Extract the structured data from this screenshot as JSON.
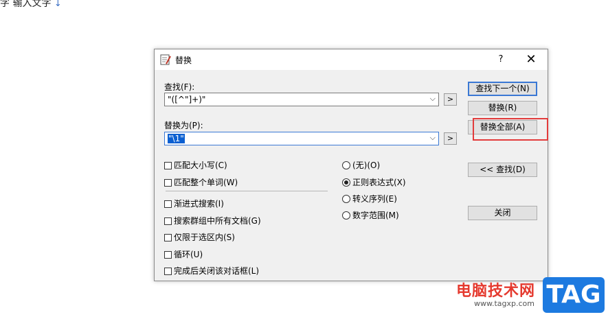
{
  "document": {
    "visible_text": "字 输入文字",
    "para_mark": "↓"
  },
  "dialog": {
    "title": "替换",
    "help": "?",
    "close": "✕",
    "find_label": "查找(F):",
    "find_value": "\"([^\"]+)\"",
    "replace_label": "替换为(P):",
    "replace_value": "\"\\1\"",
    "expand_button": ">",
    "buttons": {
      "find_next": "查找下一个(N)",
      "replace": "替换(R)",
      "replace_all": "替换全部(A)",
      "find_less": "<< 查找(D)",
      "close": "关闭"
    },
    "checkboxes": [
      "匹配大小写(C)",
      "匹配整个单词(W)",
      "渐进式搜索(I)",
      "搜索群组中所有文档(G)",
      "仅限于选区内(S)",
      "循环(U)",
      "完成后关闭该对话框(L)"
    ],
    "radios": [
      {
        "label": "(无)(O)",
        "selected": false
      },
      {
        "label": "正则表达式(X)",
        "selected": true
      },
      {
        "label": "转义序列(E)",
        "selected": false
      },
      {
        "label": "数字范围(M)",
        "selected": false
      }
    ]
  },
  "watermark": {
    "site_name": "电脑技术网",
    "url": "www.tagxp.com",
    "tag": "TAG"
  },
  "colors": {
    "highlight": "#e23b3b",
    "selection": "#0a5fd1",
    "tag_bg": "#1d7ae0"
  }
}
